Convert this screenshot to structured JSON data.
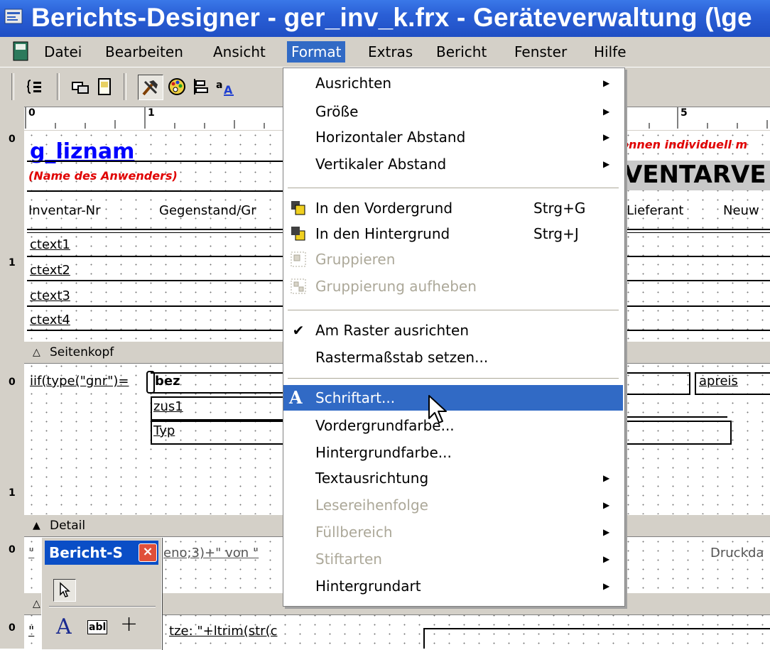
{
  "window": {
    "title": "Berichts-Designer - ger_inv_k.frx - Geräteverwaltung (\\ge"
  },
  "menubar": {
    "items": [
      {
        "label": "Datei"
      },
      {
        "label": "Bearbeiten"
      },
      {
        "label": "Ansicht"
      },
      {
        "label": "Format"
      },
      {
        "label": "Extras"
      },
      {
        "label": "Bericht"
      },
      {
        "label": "Fenster"
      },
      {
        "label": "Hilfe"
      }
    ]
  },
  "toolbar": {
    "icons": [
      "group-layout-icon",
      "data-environment-icon",
      "page-icon",
      "toolbox-icon",
      "palette-icon",
      "layout-align-icon",
      "font-size-icon"
    ]
  },
  "ruler": {
    "numbers": [
      "0",
      "1",
      "5"
    ]
  },
  "gutter": {
    "numbers": [
      "0",
      "1",
      "0",
      "1",
      "0",
      "0"
    ]
  },
  "report": {
    "header_fields": {
      "g_liznam": "g_liznam",
      "name_note": "(Name des Anwenders)",
      "red_note": "önnen individuell m",
      "title_fragment": "VENTARVE",
      "col_inventar": "Inventar-Nr",
      "col_gegenstand": "Gegenstand/Gr",
      "col_lieferant": "/Lieferant",
      "col_neuw": "Neuw",
      "ctext": [
        "ctext1",
        "ctext2",
        "ctext3",
        "ctext4"
      ]
    },
    "bands": {
      "seitenkopf": "Seitenkopf",
      "detail": "Detail"
    },
    "detail_fields": {
      "iif": "iif(type(\"gnr\")=",
      "bez": "bez",
      "apreis": "apreis",
      "zus1": "zus1",
      "typ": "Typ"
    },
    "footer_fields": {
      "page_expr_left": "\"",
      "page_expr": "eno;3)+\" von \"",
      "druckda": "Druckda"
    },
    "summary_fields": {
      "expr_left": "\"",
      "expr": "tze: \"+ltrim(str(c"
    }
  },
  "format_menu": {
    "items": [
      {
        "label": "Ausrichten",
        "submenu": true,
        "disabled": false
      },
      {
        "label": "Größe",
        "submenu": true,
        "disabled": false
      },
      {
        "label": "Horizontaler Abstand",
        "submenu": true,
        "disabled": false
      },
      {
        "label": "Vertikaler Abstand",
        "submenu": true,
        "disabled": false
      },
      {
        "label": "In den Vordergrund",
        "accel": "Strg+G",
        "icon": "bring-to-front-icon",
        "disabled": false
      },
      {
        "label": "In den Hintergrund",
        "accel": "Strg+J",
        "icon": "send-to-back-icon",
        "disabled": false
      },
      {
        "label": "Gruppieren",
        "icon": "group-icon",
        "disabled": true
      },
      {
        "label": "Gruppierung aufheben",
        "icon": "ungroup-icon",
        "disabled": true
      },
      {
        "label": "Am Raster ausrichten",
        "checked": true,
        "disabled": false
      },
      {
        "label": "Rastermaßstab setzen...",
        "disabled": false
      },
      {
        "label": "Schriftart...",
        "icon": "font-icon",
        "selected": true,
        "disabled": false
      },
      {
        "label": "Vordergrundfarbe...",
        "disabled": false
      },
      {
        "label": "Hintergrundfarbe...",
        "disabled": false
      },
      {
        "label": "Textausrichtung",
        "submenu": true,
        "disabled": false
      },
      {
        "label": "Lesereihenfolge",
        "submenu": true,
        "disabled": true
      },
      {
        "label": "Füllbereich",
        "submenu": true,
        "disabled": true
      },
      {
        "label": "Stiftarten",
        "submenu": true,
        "disabled": true
      },
      {
        "label": "Hintergrundart",
        "submenu": true,
        "disabled": false
      }
    ]
  },
  "toolbox": {
    "title": "Bericht-S",
    "close": "×",
    "label_tool": "A",
    "field_tool": "abl",
    "line_tool": "+"
  },
  "colors": {
    "titlebar": "#2a5fd6",
    "menu_highlight": "#316ac5",
    "link_blue": "#0000ff",
    "red_text": "#e00000",
    "chrome": "#d4d0c8"
  }
}
